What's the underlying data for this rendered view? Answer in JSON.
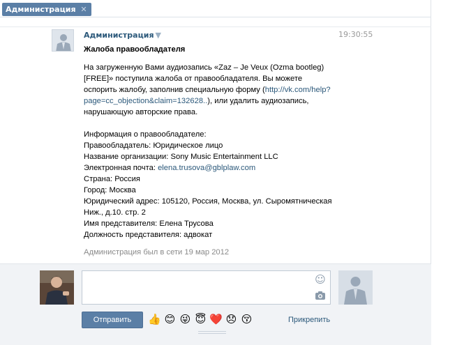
{
  "tab": {
    "label": "Администрация",
    "close": "✕"
  },
  "message": {
    "author": "Администрация",
    "author_arrow": "▼",
    "time": "19:30:55",
    "title": "Жалоба правообладателя",
    "body_pre": "На загруженную Вами аудиозапись «Zaz – Je Veux (Ozma bootleg) [FREE]» поступила жалоба от правообладателя. Вы можете оспорить жалобу, заполнив специальную форму (",
    "body_link": "http://vk.com/help?page=cc_objection&claim=132628..",
    "body_post": "), или удалить аудиозапись, нарушающую авторские права.",
    "info_header": "Информация о правообладателе:",
    "holder": "Правообладатель: Юридическое лицо",
    "org": "Название организации: Sony Music Entertainment LLC",
    "email_label": "Электронная почта: ",
    "email": "elena.trusova@gblplaw.com",
    "country": "Страна: Россия",
    "city": "Город: Москва",
    "address_1": "Юридический адрес: 105120, Россия, Москва, ул. Сыромятническая",
    "address_2": "Ниж., д.10. стр. 2",
    "rep_name": "Имя представителя: Елена Трусова",
    "rep_position": "Должность представителя: адвокат"
  },
  "online_status": "Администрация был в сети 19 мар 2012",
  "compose": {
    "input_value": "",
    "send_label": "Отправить",
    "attach_label": "Прикрепить",
    "emojis": [
      "👍",
      "😊",
      "😜",
      "😇",
      "❤️",
      "😞",
      "😚"
    ]
  },
  "colors": {
    "accent": "#5b7fa6",
    "link": "#2b587a",
    "muted": "#999999"
  },
  "icons": {
    "tab_close": "close-icon",
    "smile": "smile-icon",
    "camera": "camera-icon"
  }
}
